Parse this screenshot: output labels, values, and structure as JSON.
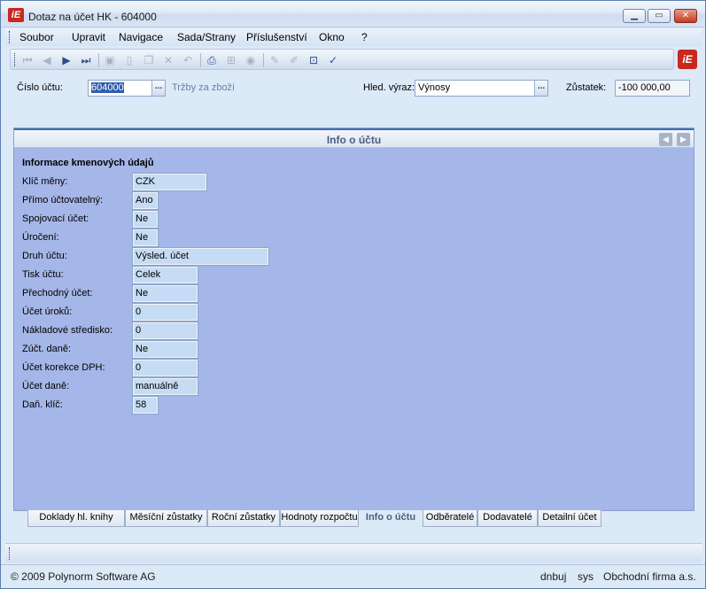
{
  "window": {
    "title": "Dotaz na účet HK - 604000",
    "logo_text": "iE",
    "buttons": [
      "minimize",
      "maximize",
      "close"
    ]
  },
  "menu": [
    "Soubor",
    "Upravit",
    "Navigace",
    "Sada/Strany",
    "Příslušenství",
    "Okno",
    "?"
  ],
  "toolbar": {
    "icons": [
      "first-record-icon",
      "prev-record-icon",
      "next-record-icon",
      "last-record-icon",
      "save-icon",
      "new-document-icon",
      "copy-icon",
      "delete-icon",
      "undo-icon",
      "print-icon",
      "tree-icon",
      "disk-icon",
      "pen-icon",
      "pencil-icon",
      "export-icon",
      "filter-icon"
    ]
  },
  "header": {
    "account_label": "Číslo účtu:",
    "account_value": "604000",
    "account_desc": "Tržby za zboží",
    "search_label": "Hled. výraz:",
    "search_value": "Výnosy",
    "balance_label": "Zůstatek:",
    "balance_value": "-100 000,00",
    "ellipsis": "..."
  },
  "panel": {
    "title": "Info o účtu",
    "section_title": "Informace kmenových údajů",
    "rows": [
      {
        "label": "Klíč měny:",
        "value": "CZK"
      },
      {
        "label": "Přímo účtovatelný:",
        "value": "Ano"
      },
      {
        "label": "Spojovací účet:",
        "value": "Ne"
      },
      {
        "label": "Úročení:",
        "value": "Ne"
      },
      {
        "label": "Druh účtu:",
        "value": "Výsled. účet"
      },
      {
        "label": "Tisk účtu:",
        "value": "Celek"
      },
      {
        "label": "Přechodný účet:",
        "value": "Ne"
      },
      {
        "label": "Účet úroků:",
        "value": "0"
      },
      {
        "label": "Nákladové středisko:",
        "value": "0"
      },
      {
        "label": "Zúčt. daně:",
        "value": "Ne"
      },
      {
        "label": "Účet korekce DPH:",
        "value": "0"
      },
      {
        "label": "Účet daně:",
        "value": "manuálně"
      },
      {
        "label": "Daň. klíč:",
        "value": "58"
      }
    ]
  },
  "tabs": [
    "Doklady hl. knihy",
    "Měsíční zůstatky",
    "Roční zůstatky",
    "Hodnoty rozpočtu",
    "Info o účtu",
    "Odběratelé",
    "Dodavatelé",
    "Detailní účet"
  ],
  "active_tab": "Info o účtu",
  "status": {
    "copyright": "© 2009 Polynorm Software AG",
    "db": "dnbuj",
    "user": "sys",
    "company": "Obchodní firma a.s."
  }
}
